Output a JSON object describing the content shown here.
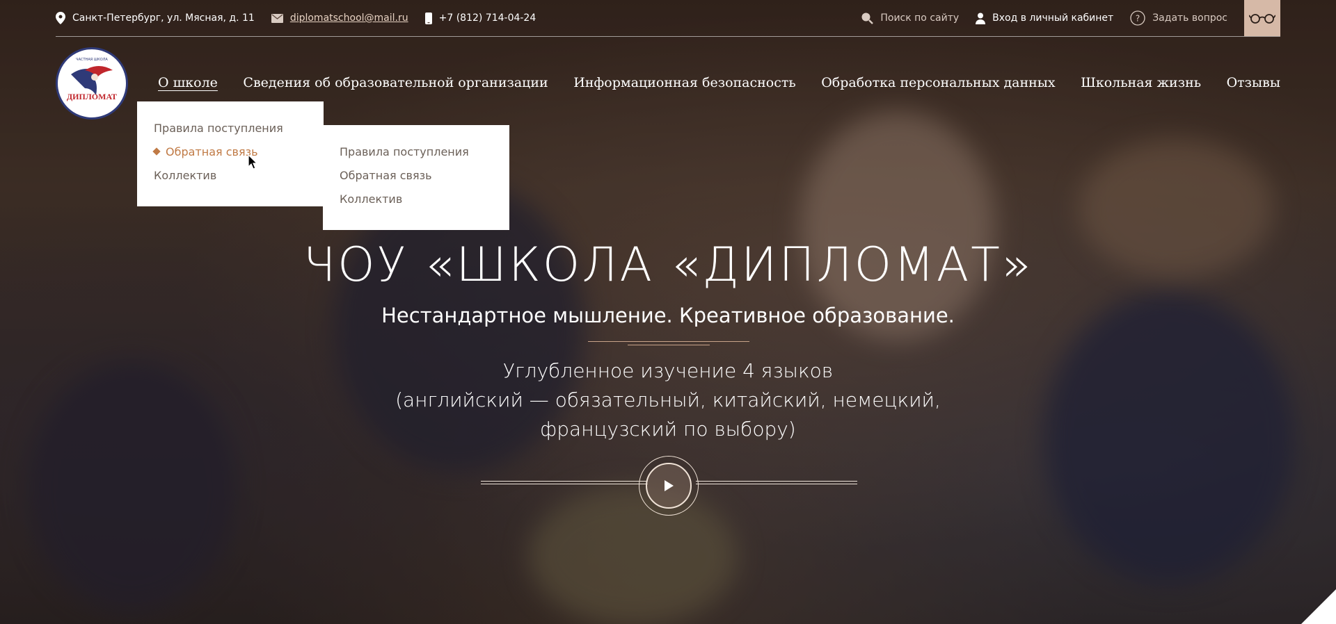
{
  "topbar": {
    "address": "Санкт-Петербург, ул. Мясная, д. 11",
    "email": "diplomatschool@mail.ru",
    "phone": "+7 (812) 714-04-24",
    "search_label": "Поиск по сайту",
    "login_label": "Вход в личный кабинет",
    "ask_label": "Задать вопрос",
    "icons": [
      "location-pin-icon",
      "mail-icon",
      "phone-icon",
      "search-icon",
      "user-icon",
      "question-icon",
      "glasses-icon"
    ]
  },
  "logo": {
    "small_text": "ЧАСТНАЯ ШКОЛА",
    "name": "ДИПЛОМАТ"
  },
  "nav": {
    "items": [
      "О школе",
      "Сведения об образовательной организации",
      "Информационная безопасность",
      "Обработка персональных данных",
      "Школьная жизнь",
      "Отзывы"
    ]
  },
  "dropdown1": {
    "items": [
      "Правила поступления",
      "Обратная связь",
      "Коллектив"
    ],
    "current": "Обратная связь"
  },
  "dropdown2": {
    "items": [
      "Правила поступления",
      "Обратная связь",
      "Коллектив"
    ]
  },
  "hero": {
    "title": "ЧОУ «ШКОЛА «ДИПЛОМАТ»",
    "subtitle": "Нестандартное мышление. Креативное образование.",
    "desc_line1": "Углубленное изучение 4 языков",
    "desc_line2": "(английский — обязательный, китайский, немецкий,",
    "desc_line3": "французский по выбору)"
  },
  "colors": {
    "accent": "#c07a45",
    "glasses_bg": "#d6b9a7",
    "logo_blue": "#2f3a78",
    "logo_red": "#c0262c"
  }
}
